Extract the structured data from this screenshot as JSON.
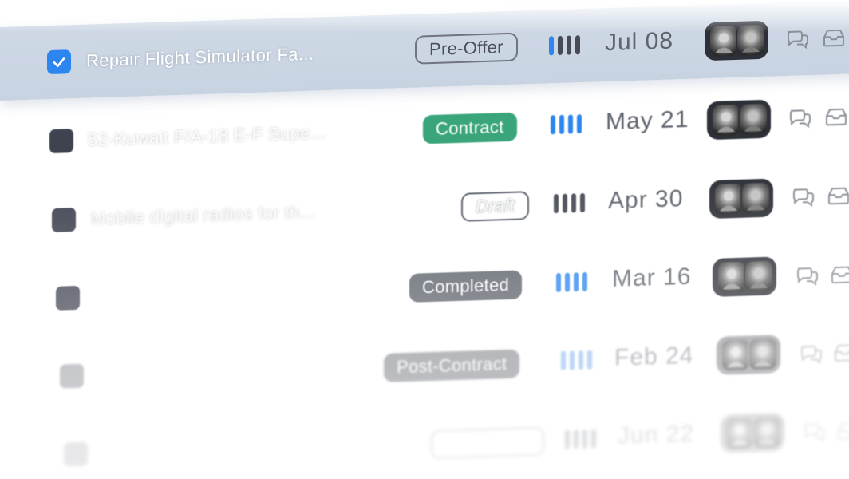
{
  "rows": [
    {
      "title": "Repair Flight Simulator Fa...",
      "status": "Pre-Offer",
      "status_style": "outline",
      "priority": 1,
      "date": "Jul 08",
      "checked": true,
      "selected": true
    },
    {
      "title": "52-Kuwait F/A-18 E-F Supe...",
      "status": "Contract",
      "status_style": "green",
      "priority": 4,
      "date": "May 21",
      "checked": false,
      "selected": false
    },
    {
      "title": "Mobile digital radios for th...",
      "status": "Draft",
      "status_style": "draft",
      "priority": 0,
      "date": "Apr 30",
      "checked": false,
      "selected": false
    },
    {
      "title": "",
      "status": "Completed",
      "status_style": "dark",
      "priority": 4,
      "date": "Mar 16",
      "checked": false,
      "selected": false
    },
    {
      "title": "",
      "status": "Post-Contract",
      "status_style": "dark",
      "priority": 4,
      "date": "Feb 24",
      "checked": false,
      "selected": false
    },
    {
      "title": "",
      "status": "",
      "status_style": "outline",
      "priority": 0,
      "date": "Jun 22",
      "checked": false,
      "selected": false
    }
  ],
  "colors": {
    "accent": "#2d86f0",
    "contract_green": "#3aa57b",
    "badge_dark": "#5b6069",
    "selected_row": "#cbd6e3"
  },
  "icons": {
    "checkbox_check": "check-icon",
    "comment": "chat-bubbles-icon",
    "inbox": "inbox-tray-icon",
    "avatar": "user-avatar-icon"
  }
}
